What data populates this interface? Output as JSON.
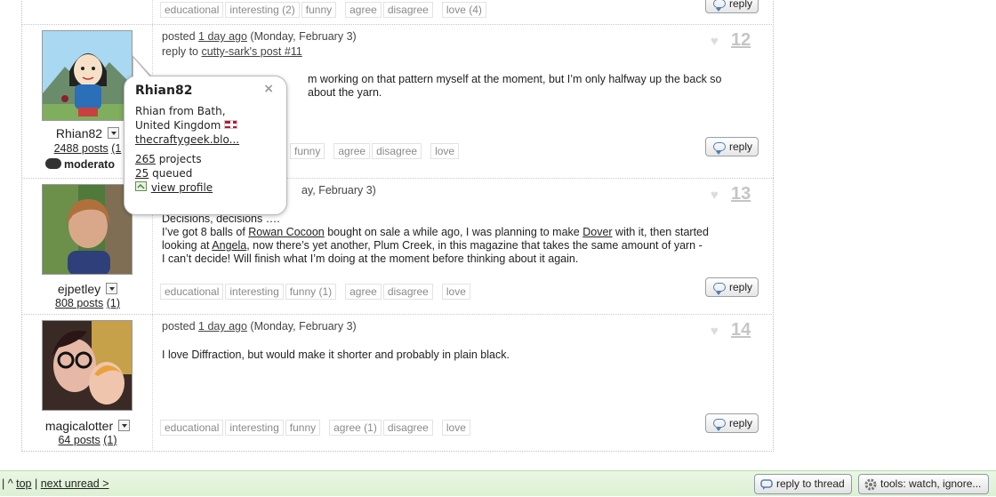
{
  "post_top": {
    "votes": [
      "educational",
      "interesting (2)",
      "funny",
      "agree",
      "disagree",
      "love (4)"
    ],
    "reply_label": "reply"
  },
  "post_12": {
    "username": "Rhian82",
    "posts_link": "2488 posts",
    "posts_extra": "(1",
    "role": "moderato",
    "meta_posted": "posted",
    "meta_time": "1 day ago",
    "meta_date": "(Monday, February 3)",
    "reply_to_prefix": "reply to",
    "reply_to_link": "cutty-sark's post #11",
    "body_line1": "m working on that pattern myself at the moment, but I’m only halfway up the back so",
    "body_line2": "about the yarn.",
    "votes": [
      "funny",
      "agree",
      "disagree",
      "love"
    ],
    "reply_label": "reply",
    "number": "12"
  },
  "popup": {
    "name": "Rhian82",
    "close": "×",
    "location_line1": "Rhian from Bath,",
    "location_line2": "United Kingdom",
    "website": "thecraftygeek.blo...",
    "projects_count": "265",
    "projects_label": "projects",
    "queued_count": "25",
    "queued_label": "queued",
    "view_profile": "view profile"
  },
  "post_13": {
    "username": "ejpetley",
    "posts_link": "808 posts",
    "posts_extra": "(1)",
    "meta_visible": "ay, February 3)",
    "body_title": "Decisions, decisions ….",
    "body_p1": "I’ve got 8 balls of ",
    "link1": "Rowan Cocoon",
    "body_p2": " bought on sale a while ago, I was planning to make ",
    "link2": "Dover",
    "body_p3": " with it, then started",
    "body_p4": "looking at ",
    "link3": "Angela",
    "body_p5": ", now there’s yet another, Plum Creek, in this magazine that takes the same amount of yarn -",
    "body_p6": "I can’t decide! Will finish what I’m doing at the moment before thinking about it again.",
    "votes": [
      "educational",
      "interesting",
      "funny (1)",
      "agree",
      "disagree",
      "love"
    ],
    "reply_label": "reply",
    "number": "13"
  },
  "post_14": {
    "username": "magicalotter",
    "posts_link": "64 posts",
    "posts_extra": "(1)",
    "meta_posted": "posted",
    "meta_time": "1 day ago",
    "meta_date": "(Monday, February 3)",
    "body": "I love Diffraction, but would make it shorter and probably in plain black.",
    "votes": [
      "educational",
      "interesting",
      "funny",
      "agree (1)",
      "disagree",
      "love"
    ],
    "reply_label": "reply",
    "number": "14"
  },
  "bottombar": {
    "sep1": "|",
    "caret": "^",
    "top": "top",
    "sep2": "|",
    "next_unread": "next unread >",
    "reply_to_thread": "reply to thread",
    "tools": "tools: watch, ignore..."
  },
  "icons": [
    "heart-icon",
    "reply-bubble-icon",
    "dropdown-icon",
    "flag-uk-icon",
    "profile-icon",
    "gear-icon",
    "sheep-icon"
  ]
}
